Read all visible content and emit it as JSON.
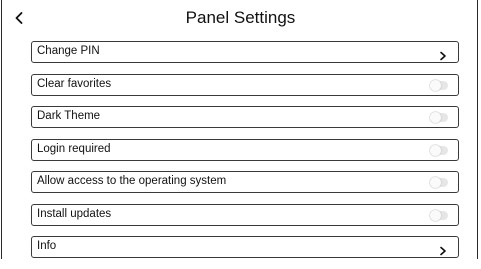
{
  "header": {
    "title": "Panel Settings",
    "back_icon": "chevron-left-icon"
  },
  "settings": [
    {
      "label": "Change PIN",
      "kind": "link",
      "icon": "chevron-right-icon"
    },
    {
      "label": "Clear favorites",
      "kind": "toggle",
      "enabled": false
    },
    {
      "label": "Dark Theme",
      "kind": "toggle",
      "enabled": false
    },
    {
      "label": "Login required",
      "kind": "toggle",
      "enabled": false
    },
    {
      "label": "Allow access to the operating system",
      "kind": "toggle",
      "enabled": false
    },
    {
      "label": "Install updates",
      "kind": "toggle",
      "enabled": false
    },
    {
      "label": "Info",
      "kind": "link",
      "icon": "chevron-right-icon"
    }
  ],
  "colors": {
    "border": "#3a3a3a",
    "toggle_track_off": "#e6e6e6",
    "text": "#111111"
  }
}
